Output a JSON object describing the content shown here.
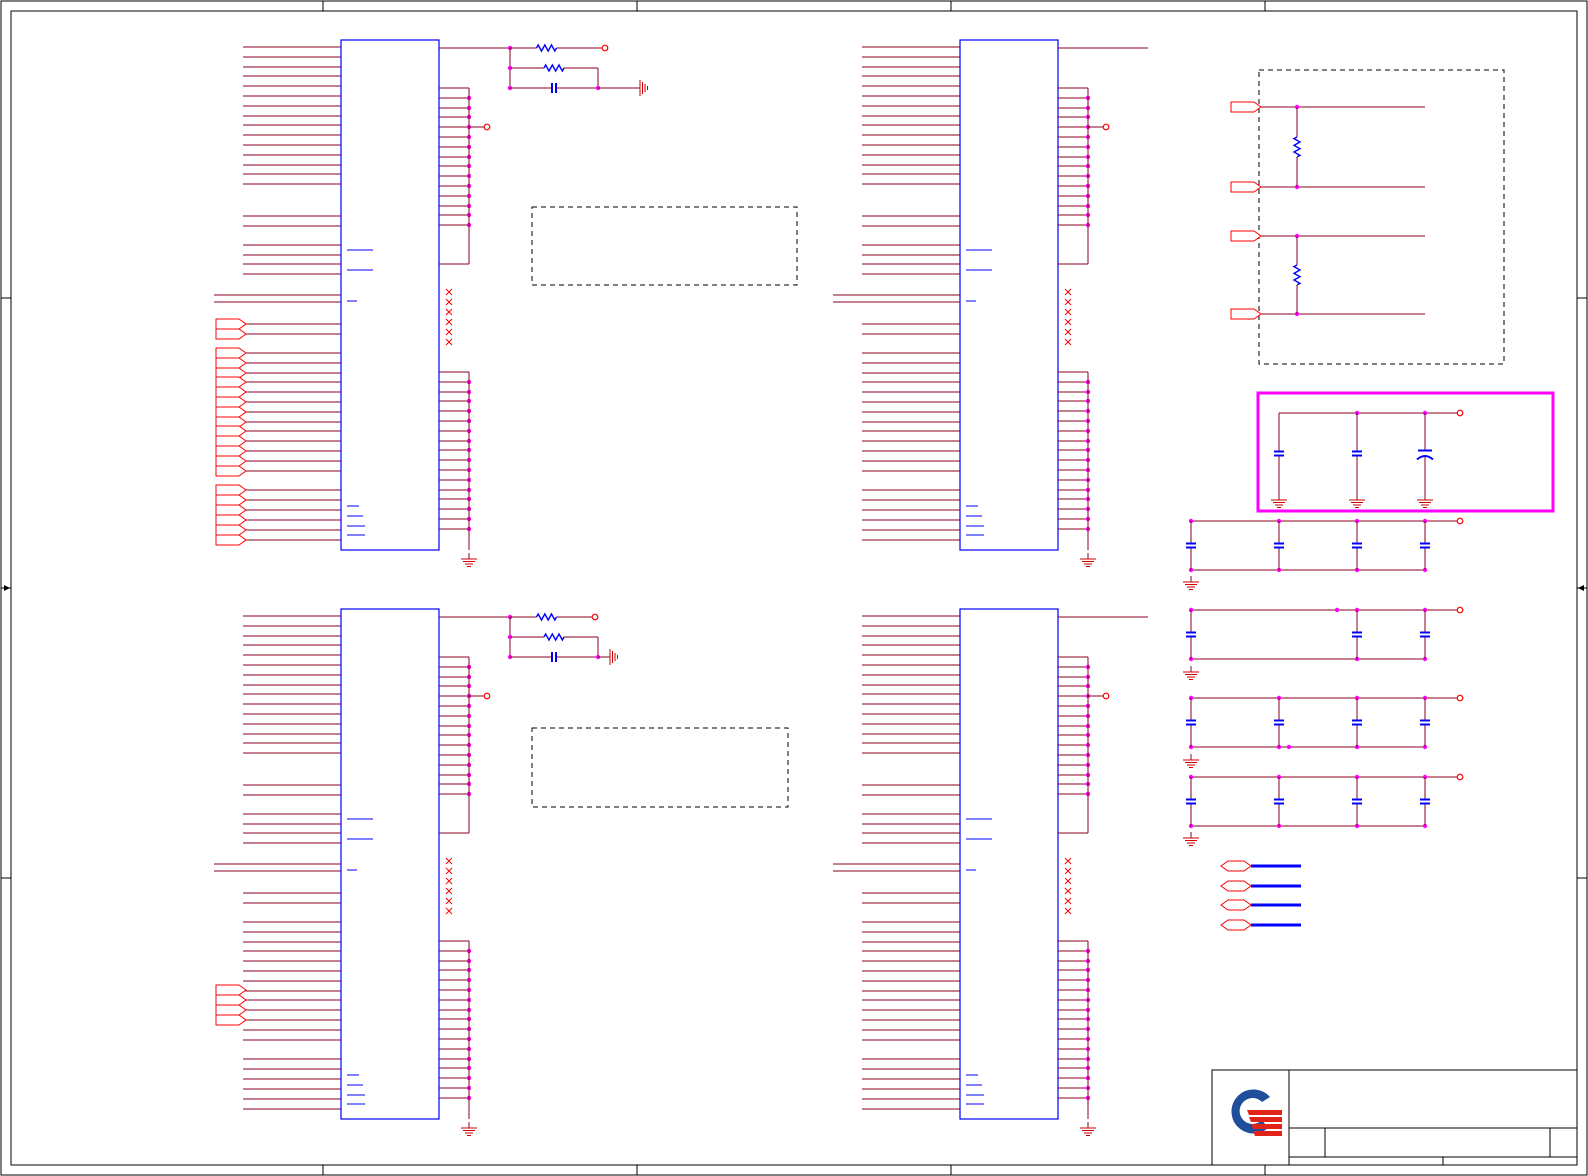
{
  "sheet": {
    "title_block": {
      "logo": "company-logo",
      "title": "",
      "doc_number": "",
      "revision": ""
    }
  },
  "colors": {
    "wire": "#8b0020",
    "pin_port": "#ff0000",
    "chip_outline": "#0000ff",
    "junction": "#ff00ff",
    "highlight_box": "#ff00ff",
    "component": "#0000ff",
    "border": "#000000",
    "ground": "#cc0000",
    "logo_blue": "#1f4e9a",
    "logo_red": "#e2231a"
  },
  "icons": {
    "resistor": "resistor-icon",
    "capacitor": "capacitor-icon",
    "polarized_capacitor": "polarized-capacitor-icon",
    "ground": "ground-icon",
    "power_port": "power-port-icon",
    "off_page_connector": "off-page-connector-icon",
    "no_connect": "no-connect-icon"
  }
}
